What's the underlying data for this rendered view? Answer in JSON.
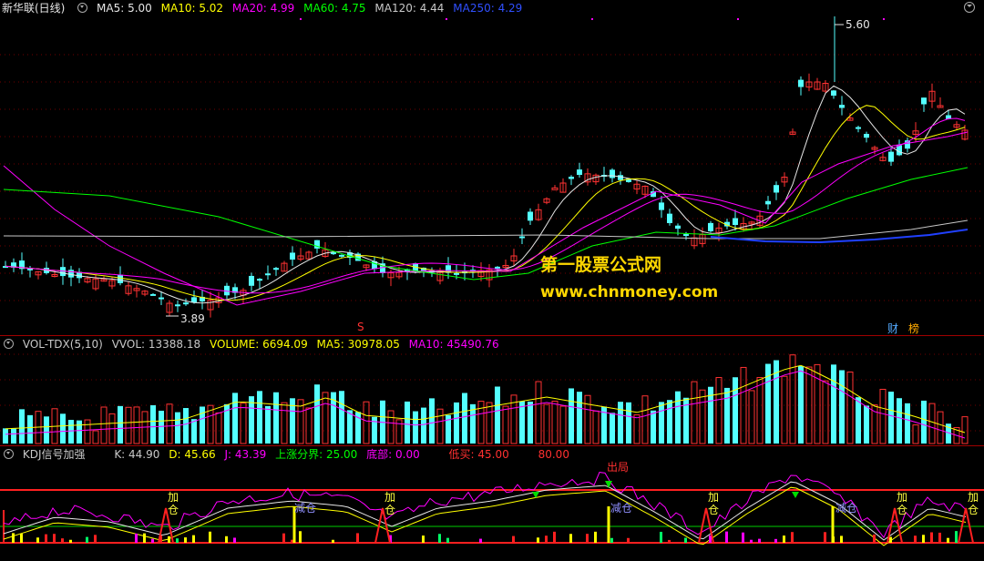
{
  "main": {
    "stock_name": "新华联(日线)",
    "ma": [
      {
        "label": "MA5: 5.00",
        "color": "#e6e6e6"
      },
      {
        "label": "MA10: 5.02",
        "color": "#ffff00"
      },
      {
        "label": "MA20: 4.99",
        "color": "#ff00ff"
      },
      {
        "label": "MA60: 4.75",
        "color": "#00ff00"
      },
      {
        "label": "MA120: 4.44",
        "color": "#c8c8c8"
      },
      {
        "label": "MA250: 4.29",
        "color": "#0000ff"
      }
    ],
    "high_label": "5.60",
    "low_label": "3.89",
    "watermark_cn": "第一股票公式网",
    "watermark_url": "www.chnmoney.com",
    "marker_s": "S",
    "marker_cai": "财",
    "marker_bang": "榜"
  },
  "volume": {
    "title": "VOL-TDX(5,10)",
    "values": [
      {
        "label": "VVOL: 13388.18",
        "color": "#c8c8c8"
      },
      {
        "label": "VOLUME: 6694.09",
        "color": "#ffff00"
      },
      {
        "label": "MA5: 30978.05",
        "color": "#ffff00"
      },
      {
        "label": "MA10: 45490.76",
        "color": "#ff00ff"
      }
    ]
  },
  "kdj": {
    "title": "KDJ信号加强",
    "values": [
      {
        "label": "K: 44.90",
        "color": "#c8c8c8"
      },
      {
        "label": "D: 45.66",
        "color": "#ffff00"
      },
      {
        "label": "J: 43.39",
        "color": "#ff00ff"
      },
      {
        "label": "上涨分界: 25.00",
        "color": "#00ff00"
      },
      {
        "label": "底部: 0.00",
        "color": "#ff00ff"
      },
      {
        "label": "低买: 45.00",
        "color": "#ff3030"
      },
      {
        "label": "80.00",
        "color": "#ff3030"
      }
    ],
    "signals": {
      "add": "加仓",
      "reduce": "减仓",
      "top": "出局"
    }
  },
  "colors": {
    "up": "#ff3232",
    "down": "#54ffff",
    "divider": "#a00000"
  }
}
